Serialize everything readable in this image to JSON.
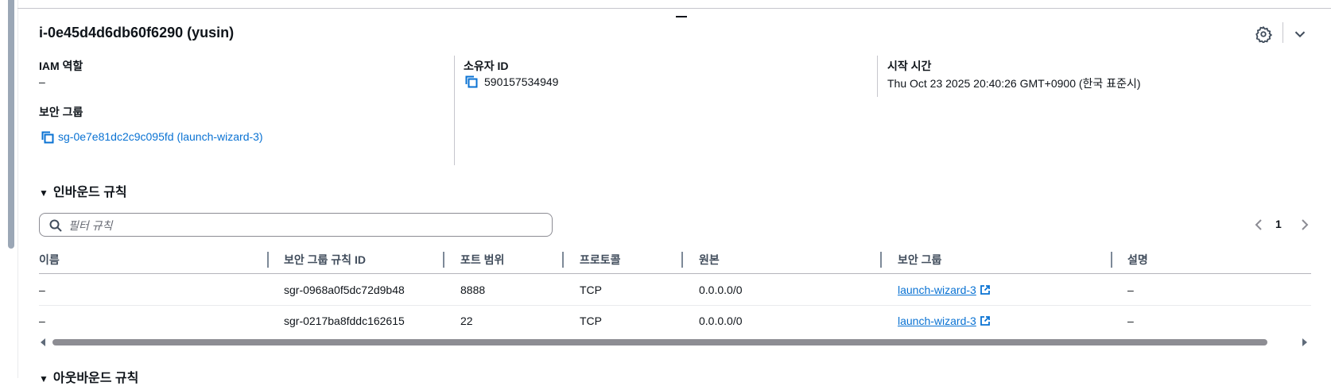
{
  "instance": {
    "title": "i-0e45d4d6db60f6290 (yusin)"
  },
  "details": {
    "iam_role_label": "IAM 역할",
    "iam_role_value": "–",
    "owner_id_label": "소유자 ID",
    "owner_id_value": "590157534949",
    "launch_time_label": "시작 시간",
    "launch_time_value": "Thu Oct 23 2025 20:40:26 GMT+0900 (한국 표준시)",
    "security_groups_label": "보안 그룹",
    "security_group_link": "sg-0e7e81dc2c9c095fd (launch-wizard-3)"
  },
  "inbound": {
    "heading": "인바운드 규칙",
    "filter_placeholder": "필터 규칙",
    "page": "1",
    "columns": [
      "이름",
      "보안 그룹 규칙 ID",
      "포트 범위",
      "프로토콜",
      "원본",
      "보안 그룹",
      "설명"
    ],
    "rows": [
      {
        "name": "–",
        "rule_id": "sgr-0968a0f5dc72d9b48",
        "port": "8888",
        "protocol": "TCP",
        "source": "0.0.0.0/0",
        "sg": "launch-wizard-3",
        "desc": "–"
      },
      {
        "name": "–",
        "rule_id": "sgr-0217ba8fddc162615",
        "port": "22",
        "protocol": "TCP",
        "source": "0.0.0.0/0",
        "sg": "launch-wizard-3",
        "desc": "–"
      }
    ]
  },
  "outbound": {
    "heading": "아웃바운드 규칙"
  },
  "icons": {
    "settings": "gear-icon",
    "collapse": "chevron-down-icon",
    "copy": "copy-icon",
    "search": "search-icon",
    "external": "external-link-icon"
  },
  "colors": {
    "link": "#0972d3",
    "text": "#0f141a"
  }
}
